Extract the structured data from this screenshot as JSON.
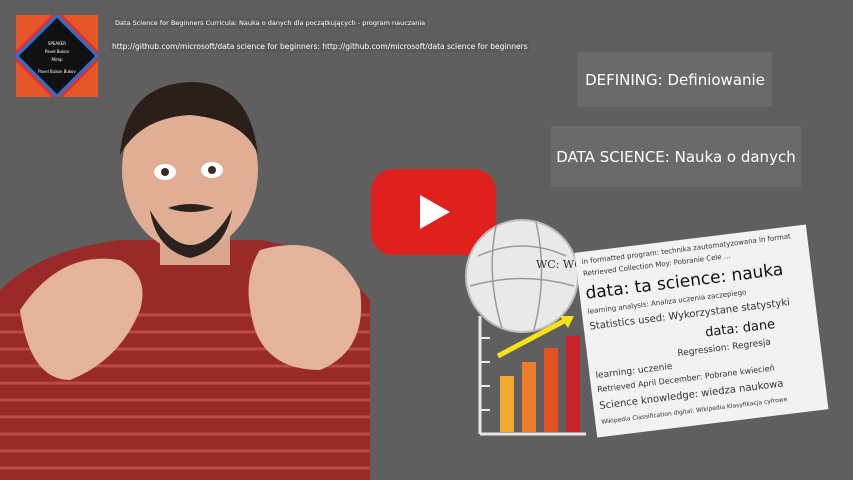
{
  "header": {
    "title": "Data Science for Beginners Curricula: Nauka o danych dla początkujących - program nauczania",
    "url": "http://github.com/microsoft/data science for beginners: http://github.com/microsoft/data science for beginners"
  },
  "thumbnail": {
    "lines": [
      "SPEAKER",
      "Pavel Bukov",
      "Mimp",
      "Pavel Bukov Bukov"
    ]
  },
  "terms": [
    {
      "text": "DEFINING: Definiowanie"
    },
    {
      "text": "DATA SCIENCE: Nauka o danych"
    }
  ],
  "video": {
    "play_icon": "play-icon",
    "colors": {
      "play": "#e0201c",
      "background": "#5f5f5f",
      "shirt": "#9a2a2a"
    }
  },
  "globe": {
    "label": "WC: WC"
  },
  "chart_icon": {
    "bar_colors": [
      "#f1a92f",
      "#ee7d2a",
      "#e4531f",
      "#c9222a"
    ],
    "arrow_color": "#f5e31a"
  },
  "wordcloud": {
    "lines": [
      "in formatted  program: technika zautomatyzowana in format",
      "Retrieved  Collection Moy: Pobranie  Cele ...",
      "data: ta  science: nauka",
      "learning analysis: Analiza uczenia  zaczepiego",
      "Statistics used: Wykorzystane statystyki",
      "data: dane",
      "Regression: Regresja",
      "learning: uczenie",
      "Retrieved April December: Pobrane kwiecień",
      "Science knowledge: wiedza naukowa",
      "Wikipedia Classification digital: Wikipedia Klasyfikacja cyfrowe"
    ]
  }
}
